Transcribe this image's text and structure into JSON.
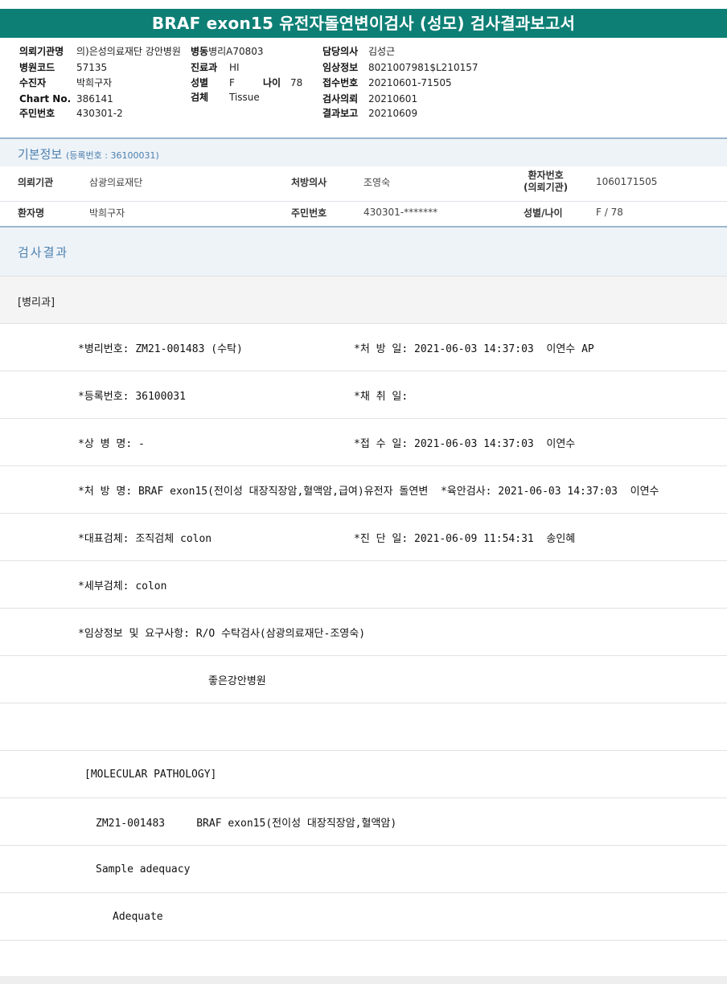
{
  "report": {
    "title": "BRAF exon15 유전자돌연변이검사 (성모) 검사결과보고서"
  },
  "header": {
    "col1": [
      {
        "label": "의뢰기관명",
        "value": "의)은성의료재단 강안병원"
      },
      {
        "label": "병원코드",
        "value": "57135"
      },
      {
        "label": "수진자",
        "value": "박희구자"
      },
      {
        "label": "Chart No.",
        "value": "386141"
      },
      {
        "label": "주민번호",
        "value": "430301-2"
      }
    ],
    "col2": [
      {
        "label": "병동",
        "value": "병리A70803"
      },
      {
        "label": "진료과",
        "value": "HI"
      },
      {
        "label": "성별",
        "value": "F"
      },
      {
        "label": "검체",
        "value": "Tissue"
      }
    ],
    "age": {
      "label": "나이",
      "value": "78"
    },
    "col3": [
      {
        "label": "담당의사",
        "value": "김성근"
      },
      {
        "label": "임상정보",
        "value": "8021007981$L210157"
      },
      {
        "label": "접수번호",
        "value": "20210601-71505"
      },
      {
        "label": "검사의뢰",
        "value": "20210601"
      },
      {
        "label": "결과보고",
        "value": "20210609"
      }
    ]
  },
  "basic_info": {
    "title": "기본정보",
    "subtitle": "(등록번호 : 36100031)",
    "row1": [
      {
        "label": "의뢰기관",
        "value": "삼광의료재단"
      },
      {
        "label": "처방의사",
        "value": "조영숙"
      },
      {
        "label": "환자번호\n(의뢰기관)",
        "value": "1060171505"
      }
    ],
    "row2": [
      {
        "label": "환자명",
        "value": "박희구자"
      },
      {
        "label": "주민번호",
        "value": "430301-*******"
      },
      {
        "label": "성별/나이",
        "value": "F / 78"
      }
    ]
  },
  "results": {
    "title": "검사결과",
    "department": "[병리과]",
    "lines": [
      {
        "left": "*병리번호: ZM21-001483 (수탁)",
        "right": "*처 방 일: 2021-06-03 14:37:03  이연수 AP"
      },
      {
        "left": "*등록번호: 36100031",
        "right": "*채 취 일:"
      },
      {
        "left": "*상 병 명: -",
        "right": "*접 수 일: 2021-06-03 14:37:03  이연수"
      },
      {
        "left": "*처 방 명: BRAF exon15(전이성 대장직장암,혈액암,급여)유전자 돌연변  *육안검사: 2021-06-03 14:37:03  이연수",
        "right": ""
      },
      {
        "left": "*대표검체: 조직검체 colon",
        "right": "*진 단 일: 2021-06-09 11:54:31  송인혜"
      },
      {
        "left": "*세부검체: colon",
        "right": ""
      },
      {
        "left": "*임상정보 및 요구사항: R/O 수탁검사(삼광의료재단-조영숙)",
        "right": ""
      },
      {
        "left": "좋은강안병원",
        "right": ""
      },
      {
        "left": "",
        "right": ""
      },
      {
        "left": "[MOLECULAR PATHOLOGY]",
        "right": ""
      },
      {
        "left": "ZM21-001483     BRAF exon15(전이성 대장직장암,혈액암)",
        "right": ""
      },
      {
        "left": "Sample adequacy",
        "right": ""
      },
      {
        "left": "Adequate",
        "right": ""
      }
    ]
  }
}
